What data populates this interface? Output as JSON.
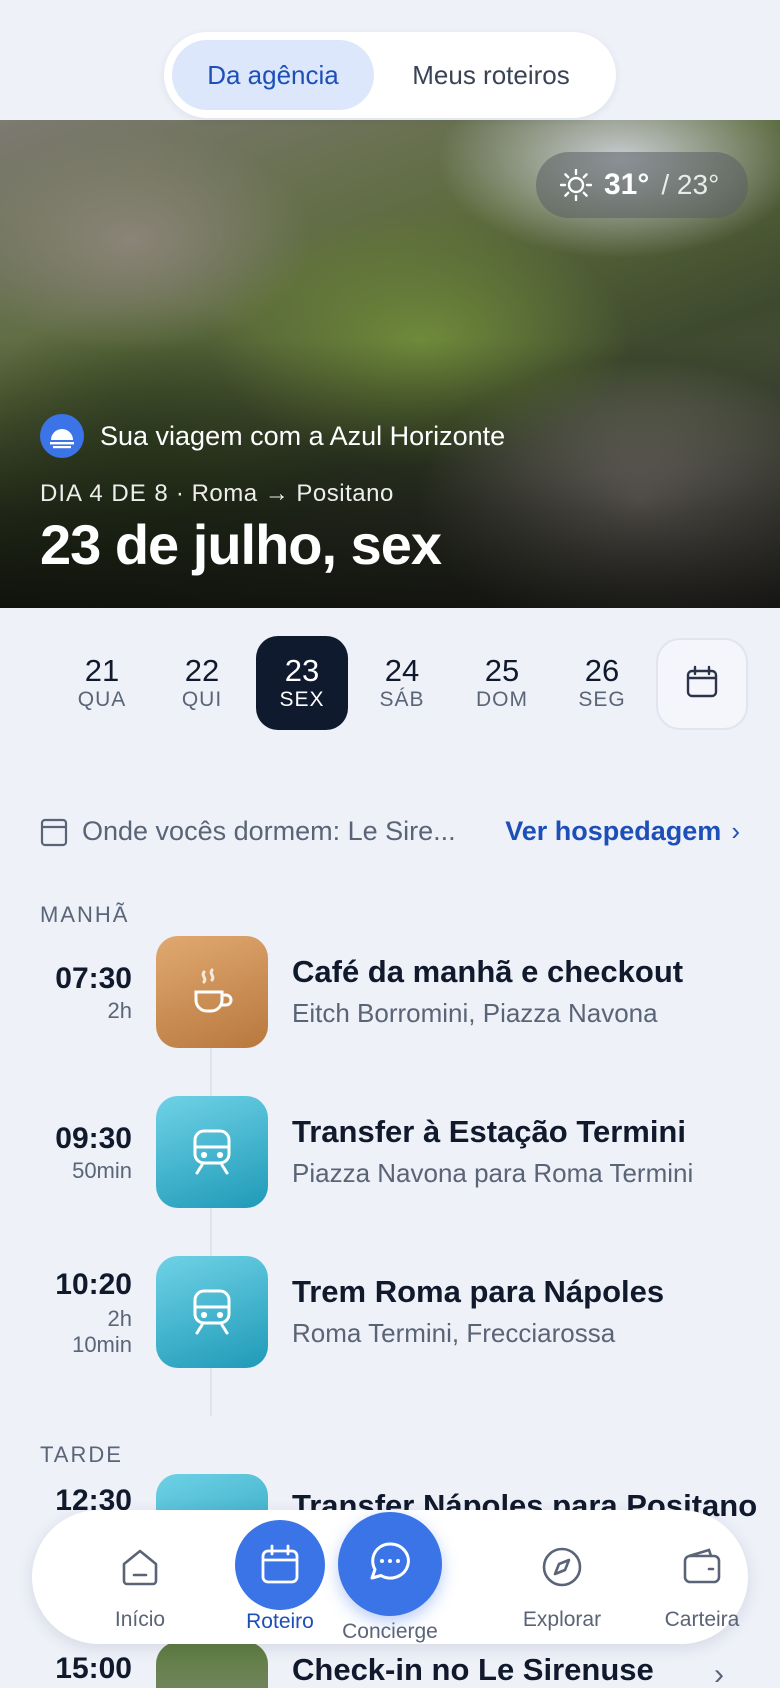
{
  "tabs": {
    "agency": "Da agência",
    "mine": "Meus roteiros"
  },
  "weather": {
    "high": "31°",
    "low": "/ 23°",
    "icon": "sun-icon"
  },
  "hero": {
    "agency_text": "Sua viagem com a Azul Horizonte",
    "day_label": "DIA 4 DE 8",
    "route": "· Roma → Positano",
    "date_title": "23 de julho, sex"
  },
  "days": [
    {
      "num": "21",
      "wd": "QUA"
    },
    {
      "num": "22",
      "wd": "QUI"
    },
    {
      "num": "23",
      "wd": "SEX"
    },
    {
      "num": "24",
      "wd": "SÁB"
    },
    {
      "num": "25",
      "wd": "DOM"
    },
    {
      "num": "26",
      "wd": "SEG"
    }
  ],
  "stay": {
    "text": "Onde vocês dormem: Le Sire...",
    "link": "Ver hospedagem",
    "chevron": "›"
  },
  "sections": {
    "morning": "MANHÃ",
    "afternoon": "TARDE"
  },
  "items": [
    {
      "time": "07:30",
      "dur": "2h",
      "title": "Café da manhã e checkout",
      "sub": "Eitch Borromini, Piazza Navona",
      "icon": "coffee-icon"
    },
    {
      "time": "09:30",
      "dur": "50min",
      "title": "Transfer à Estação Termini",
      "sub": "Piazza Navona para Roma Termini",
      "icon": "train-icon"
    },
    {
      "time": "10:20",
      "dur": "2h",
      "dur2": "10min",
      "title": "Trem Roma para Nápoles",
      "sub": "Roma Termini, Frecciarossa",
      "icon": "train-icon"
    },
    {
      "time": "12:30",
      "title": "Transfer Nápoles para Positano",
      "icon": "train-icon"
    },
    {
      "time": "15:00",
      "title": "Check-in no Le Sirenuse",
      "chevron": "›"
    }
  ],
  "nav": {
    "home": "Início",
    "itinerary": "Roteiro",
    "concierge": "Concierge",
    "explore": "Explorar",
    "wallet": "Carteira"
  },
  "colors": {
    "accent": "#3b74e6",
    "link": "#1d4fb8",
    "dark": "#0f1a2e",
    "background": "#eef1f8"
  }
}
